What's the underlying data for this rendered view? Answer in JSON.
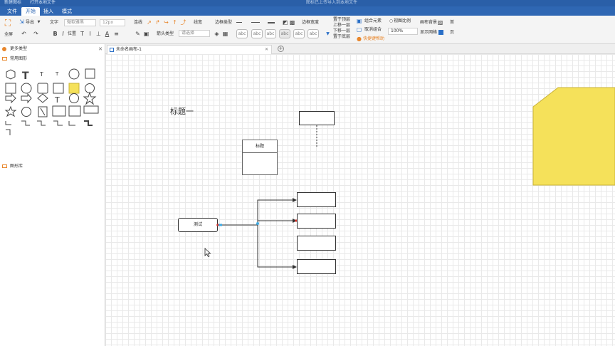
{
  "titlebar": {
    "left_items": [
      "新建图标",
      "打开本地文件"
    ],
    "center_text": "图标已上传导入到本地文件"
  },
  "menu": {
    "tabs": [
      "文件",
      "开始",
      "插入",
      "模式"
    ],
    "active": "开始"
  },
  "ribbon": {
    "fullscreen_label": "全屏",
    "export_label": "导出",
    "text_label": "文字",
    "font_family": "微软雅黑",
    "font_size": "12px",
    "align_label": "位置",
    "connector_label": "连线",
    "line_width_label": "线宽",
    "border_type_label": "边框类型",
    "arrow_type_label": "箭头类型",
    "arrow_select_placeholder": "请选择",
    "border_width_label": "边框宽度",
    "abc_samples": [
      "abc",
      "abc",
      "abc",
      "abc",
      "abc",
      "abc",
      "abc"
    ],
    "layer_items": [
      "置于顶层",
      "上移一层",
      "下移一层",
      "置于底层"
    ],
    "group_label": "组合元素",
    "ungroup_label": "取消组合",
    "quick_help_label": "快捷键帮助",
    "view_ratio_label": "视图比例",
    "zoom_value": "100%",
    "bg_label": "画布背景",
    "grid_label": "显示网格",
    "right_cut_labels": [
      "首",
      "页"
    ]
  },
  "leftpanel": {
    "more_shapes": "更多类型",
    "common_shapes": "常用图形",
    "shape_lib": "图形库"
  },
  "doc": {
    "tab_title": "未命名画布-1"
  },
  "canvas": {
    "heading_text": "标题一",
    "card_title": "标题",
    "node_label": "测试"
  },
  "colors": {
    "accent": "#2f67b3",
    "highlight_yellow": "#f5e15a",
    "connector_red": "#d9342b",
    "connector_blue": "#3fa9e0"
  }
}
